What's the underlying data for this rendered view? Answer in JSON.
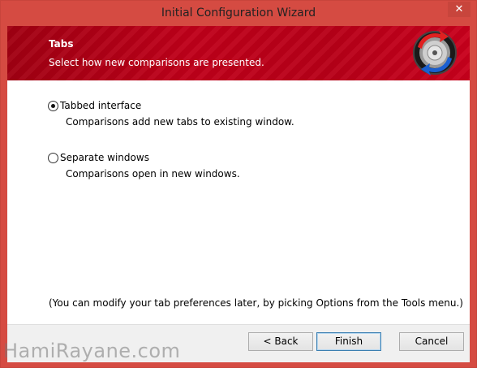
{
  "window": {
    "title": "Initial Configuration Wizard",
    "close_glyph": "✕"
  },
  "header": {
    "title": "Tabs",
    "subtitle": "Select how new comparisons are presented.",
    "logo_icon": "beyond-compare-logo-icon"
  },
  "options": [
    {
      "label": "Tabbed interface",
      "description": "Comparisons add new tabs to existing window.",
      "checked": true
    },
    {
      "label": "Separate windows",
      "description": "Comparisons open in new windows.",
      "checked": false
    }
  ],
  "note": "(You can modify your tab preferences later, by picking Options from the Tools menu.)",
  "buttons": {
    "back": "< Back",
    "finish": "Finish",
    "cancel": "Cancel"
  },
  "watermark": "HamiRayane.com",
  "colors": {
    "frame_accent": "#d54b42",
    "header_red": "#b80018"
  }
}
